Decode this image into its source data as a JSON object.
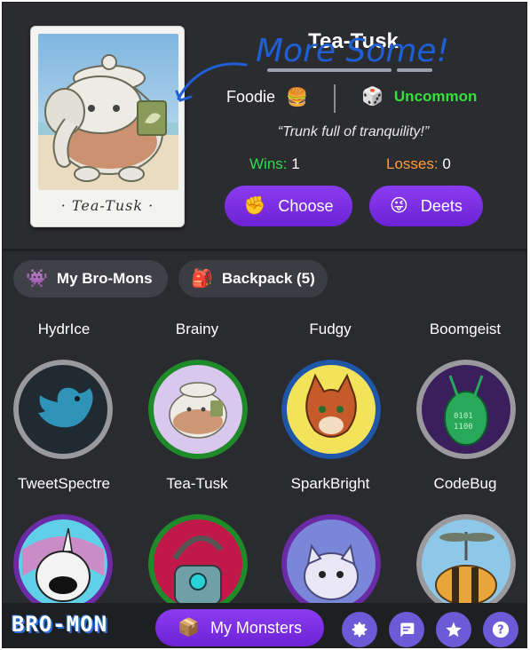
{
  "monster": {
    "name": "Tea-Tusk",
    "card_name": "· Tea-Tusk ·",
    "category": "Foodie",
    "category_emoji": "🍔",
    "rarity_emoji": "🎲",
    "rarity": "Uncommon",
    "tagline": "“Trunk full of tranquility!”",
    "wins_label": "Wins:",
    "wins": "1",
    "losses_label": "Losses:",
    "losses": "0",
    "handwritten_note": "More Some!"
  },
  "actions": {
    "choose_label": "Choose",
    "choose_emoji": "✊",
    "deets_label": "Deets",
    "deets_emoji": "😜"
  },
  "tabs": [
    {
      "label": "My Bro-Mons",
      "icon": "👾",
      "active": true
    },
    {
      "label": "Backpack (5)",
      "icon": "🎒",
      "active": false
    }
  ],
  "grid": {
    "row1_labels": [
      "HydrIce",
      "Brainy",
      "Fudgy",
      "Boomgeist"
    ],
    "row2": [
      {
        "name": "TweetSpectre",
        "ring": "#9a9a9e"
      },
      {
        "name": "Tea-Tusk",
        "ring": "#1f8a2a"
      },
      {
        "name": "SparkBright",
        "ring": "#1f56a8"
      },
      {
        "name": "CodeBug",
        "ring": "#9a9a9e"
      }
    ],
    "row3_rings": [
      "#6b2aa6",
      "#1f8a2a",
      "#6b2aa6",
      "#9a9a9e"
    ]
  },
  "bottom_bar": {
    "logo": "BRO-MON",
    "my_monsters_label": "My Monsters",
    "my_monsters_emoji": "📦",
    "buttons": [
      "gear-icon",
      "chat-icon",
      "star-icon",
      "help-icon"
    ],
    "button_color": "#6b5bd6"
  },
  "colors": {
    "background": "#2a2b2e",
    "accent": "#7c2fe6",
    "wins": "#2fdc4a",
    "losses": "#ff9a3a",
    "rarity": "#35e03c",
    "note_ink": "#1f5fd6"
  }
}
